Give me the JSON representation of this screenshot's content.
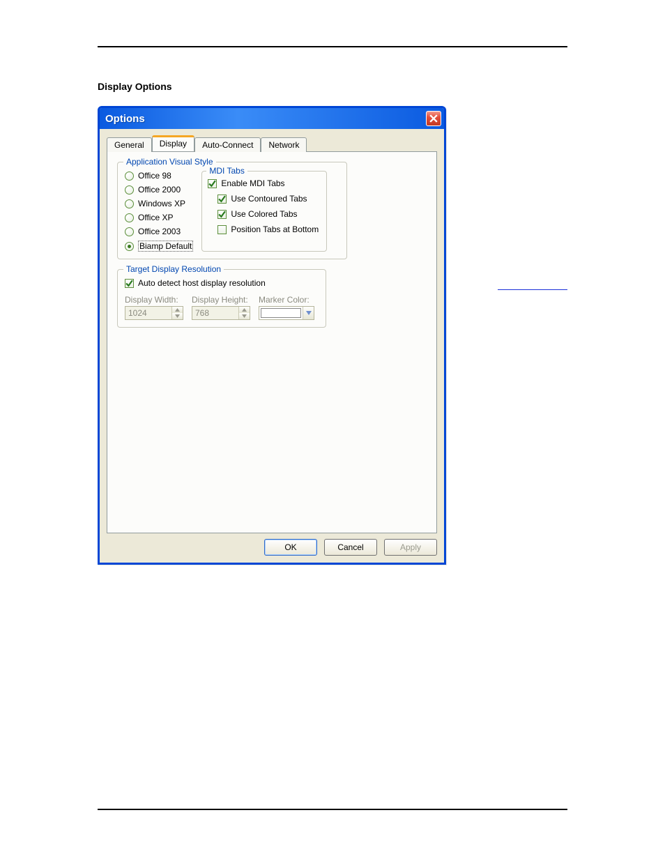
{
  "page": {
    "heading": "Display Options"
  },
  "dialog": {
    "title": "Options",
    "tabs": {
      "general": "General",
      "display": "Display",
      "autoconnect": "Auto-Connect",
      "network": "Network"
    },
    "visualStyle": {
      "legend": "Application Visual Style",
      "options": {
        "o98": "Office 98",
        "o2000": "Office 2000",
        "winxp": "Windows XP",
        "oxp": "Office XP",
        "o2003": "Office 2003",
        "biamp": "Biamp Default"
      },
      "selected": "biamp"
    },
    "mdiTabs": {
      "legend": "MDI Tabs",
      "enable": {
        "label": "Enable MDI Tabs",
        "checked": true
      },
      "contoured": {
        "label": "Use Contoured Tabs",
        "checked": true
      },
      "colored": {
        "label": "Use Colored Tabs",
        "checked": true
      },
      "bottom": {
        "label": "Position Tabs at Bottom",
        "checked": false
      }
    },
    "targetRes": {
      "legend": "Target Display Resolution",
      "autodetect": {
        "label": "Auto detect host display resolution",
        "checked": true
      },
      "widthLabel": "Display Width:",
      "heightLabel": "Display Height:",
      "markerLabel": "Marker Color:",
      "width": "1024",
      "height": "768"
    },
    "buttons": {
      "ok": "OK",
      "cancel": "Cancel",
      "apply": "Apply"
    }
  }
}
